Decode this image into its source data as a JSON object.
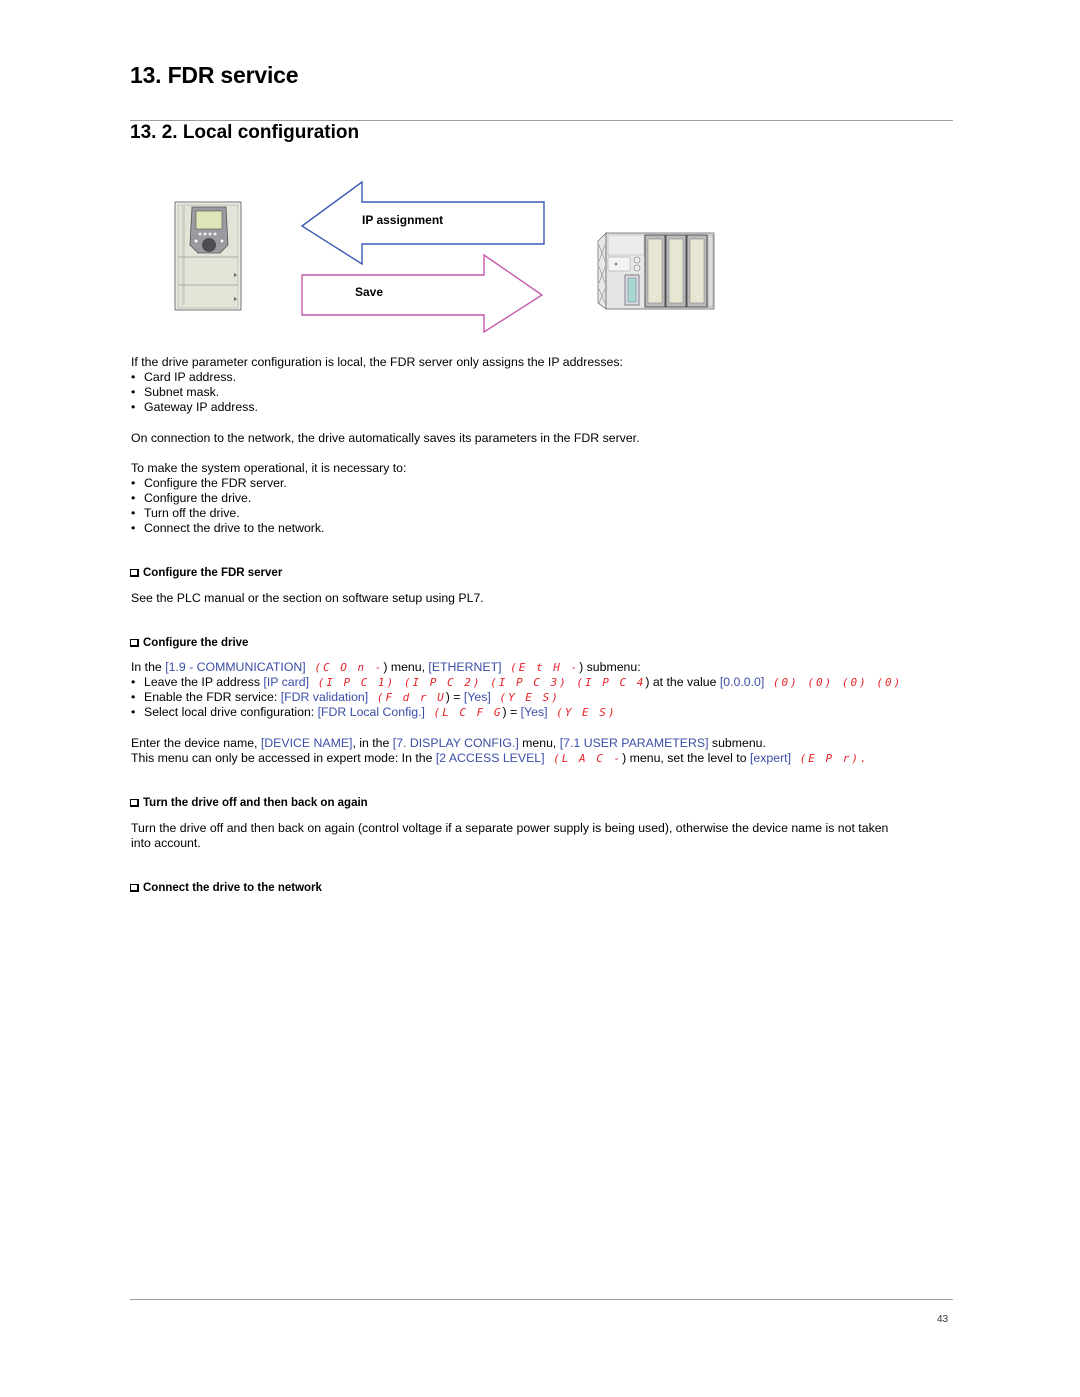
{
  "header": {
    "chapter_title": "13. FDR service",
    "section_title": "13. 2. Local configuration"
  },
  "diagram": {
    "arrow_top_label": "IP assignment",
    "arrow_bottom_label": "Save",
    "arrow_top_color": "#3b5bb5",
    "arrow_bottom_color": "#c45aaa",
    "left_device": "drive-icon",
    "right_device": "plc-icon"
  },
  "intro": {
    "text": "If the drive parameter configuration is local, the FDR server only assigns the IP addresses:",
    "bullets": [
      "Card IP address.",
      "Subnet mask.",
      "Gateway IP address."
    ]
  },
  "connection_text": "On connection to the network, the drive automatically saves its parameters in the FDR server.",
  "operational": {
    "text": "To make the system operational, it is necessary to:",
    "bullets": [
      "Configure the FDR server.",
      "Configure the drive.",
      "Turn off the drive.",
      "Connect the drive to the network."
    ]
  },
  "sections": {
    "fdr_server": {
      "heading": "Configure the FDR server",
      "text": "See the PLC manual or the section on software setup using PL7."
    },
    "drive": {
      "heading": "Configure the drive",
      "line1": {
        "a": "In the ",
        "b": "[1.9 - COMMUNICATION]",
        "c": " (",
        "d": "C O n -",
        "e": ") menu, ",
        "f": "[ETHERNET]",
        "g": " (",
        "h": "E t H -",
        "i": ") submenu:"
      },
      "bullet1": {
        "a": "Leave the IP address ",
        "b": "[IP card]",
        "c1": " (",
        "d1": "I P C  1",
        "c2": ") (",
        "d2": "I P C 2",
        "c3": ") (",
        "d3": "I P C 3",
        "c4": ") (",
        "d4": "I P C 4",
        "e": ") at the value ",
        "f": "[0.0.0.0]",
        "g1": " (",
        "h1": "0",
        "g2": ") (",
        "h2": "0",
        "g3": ") (",
        "h3": "0",
        "g4": ") (",
        "h4": "0",
        "i": ")"
      },
      "bullet2": {
        "a": "Enable the FDR service: ",
        "b": "[FDR validation]",
        "c": " (",
        "d": "F d r U",
        "e": ") = ",
        "f": "[Yes]",
        "g": " (",
        "h": "Y E S",
        "i": ")"
      },
      "bullet3": {
        "a": "Select local drive configuration: ",
        "b": "[FDR Local Config.]",
        "c": " (",
        "d": "L C F G",
        "e": ") = ",
        "f": "[Yes]",
        "g": " (",
        "h": "Y E S",
        "i": ")"
      },
      "device_line1": {
        "a": "Enter the device name, ",
        "b": "[DEVICE NAME]",
        "c": ", in the ",
        "d": "[7. DISPLAY CONFIG.]",
        "e": " menu, ",
        "f": "[7.1 USER PARAMETERS]",
        "g": " submenu."
      },
      "device_line2": {
        "a": "This menu can only be accessed in expert mode: In the ",
        "b": "[2 ACCESS LEVEL]",
        "c": " (",
        "d": "L A C -",
        "e": ") menu, set the level to ",
        "f": "[expert]",
        "g": " (",
        "h": "E P r",
        "i": ")."
      }
    },
    "restart": {
      "heading": "Turn the drive off and then back on again",
      "text_line1": "Turn the drive off and then back on again (control voltage if a separate power supply is being used), otherwise the device name is not taken",
      "text_line2": "into account."
    },
    "connect": {
      "heading": "Connect the drive to the network"
    }
  },
  "footer": {
    "page_number": "43"
  }
}
